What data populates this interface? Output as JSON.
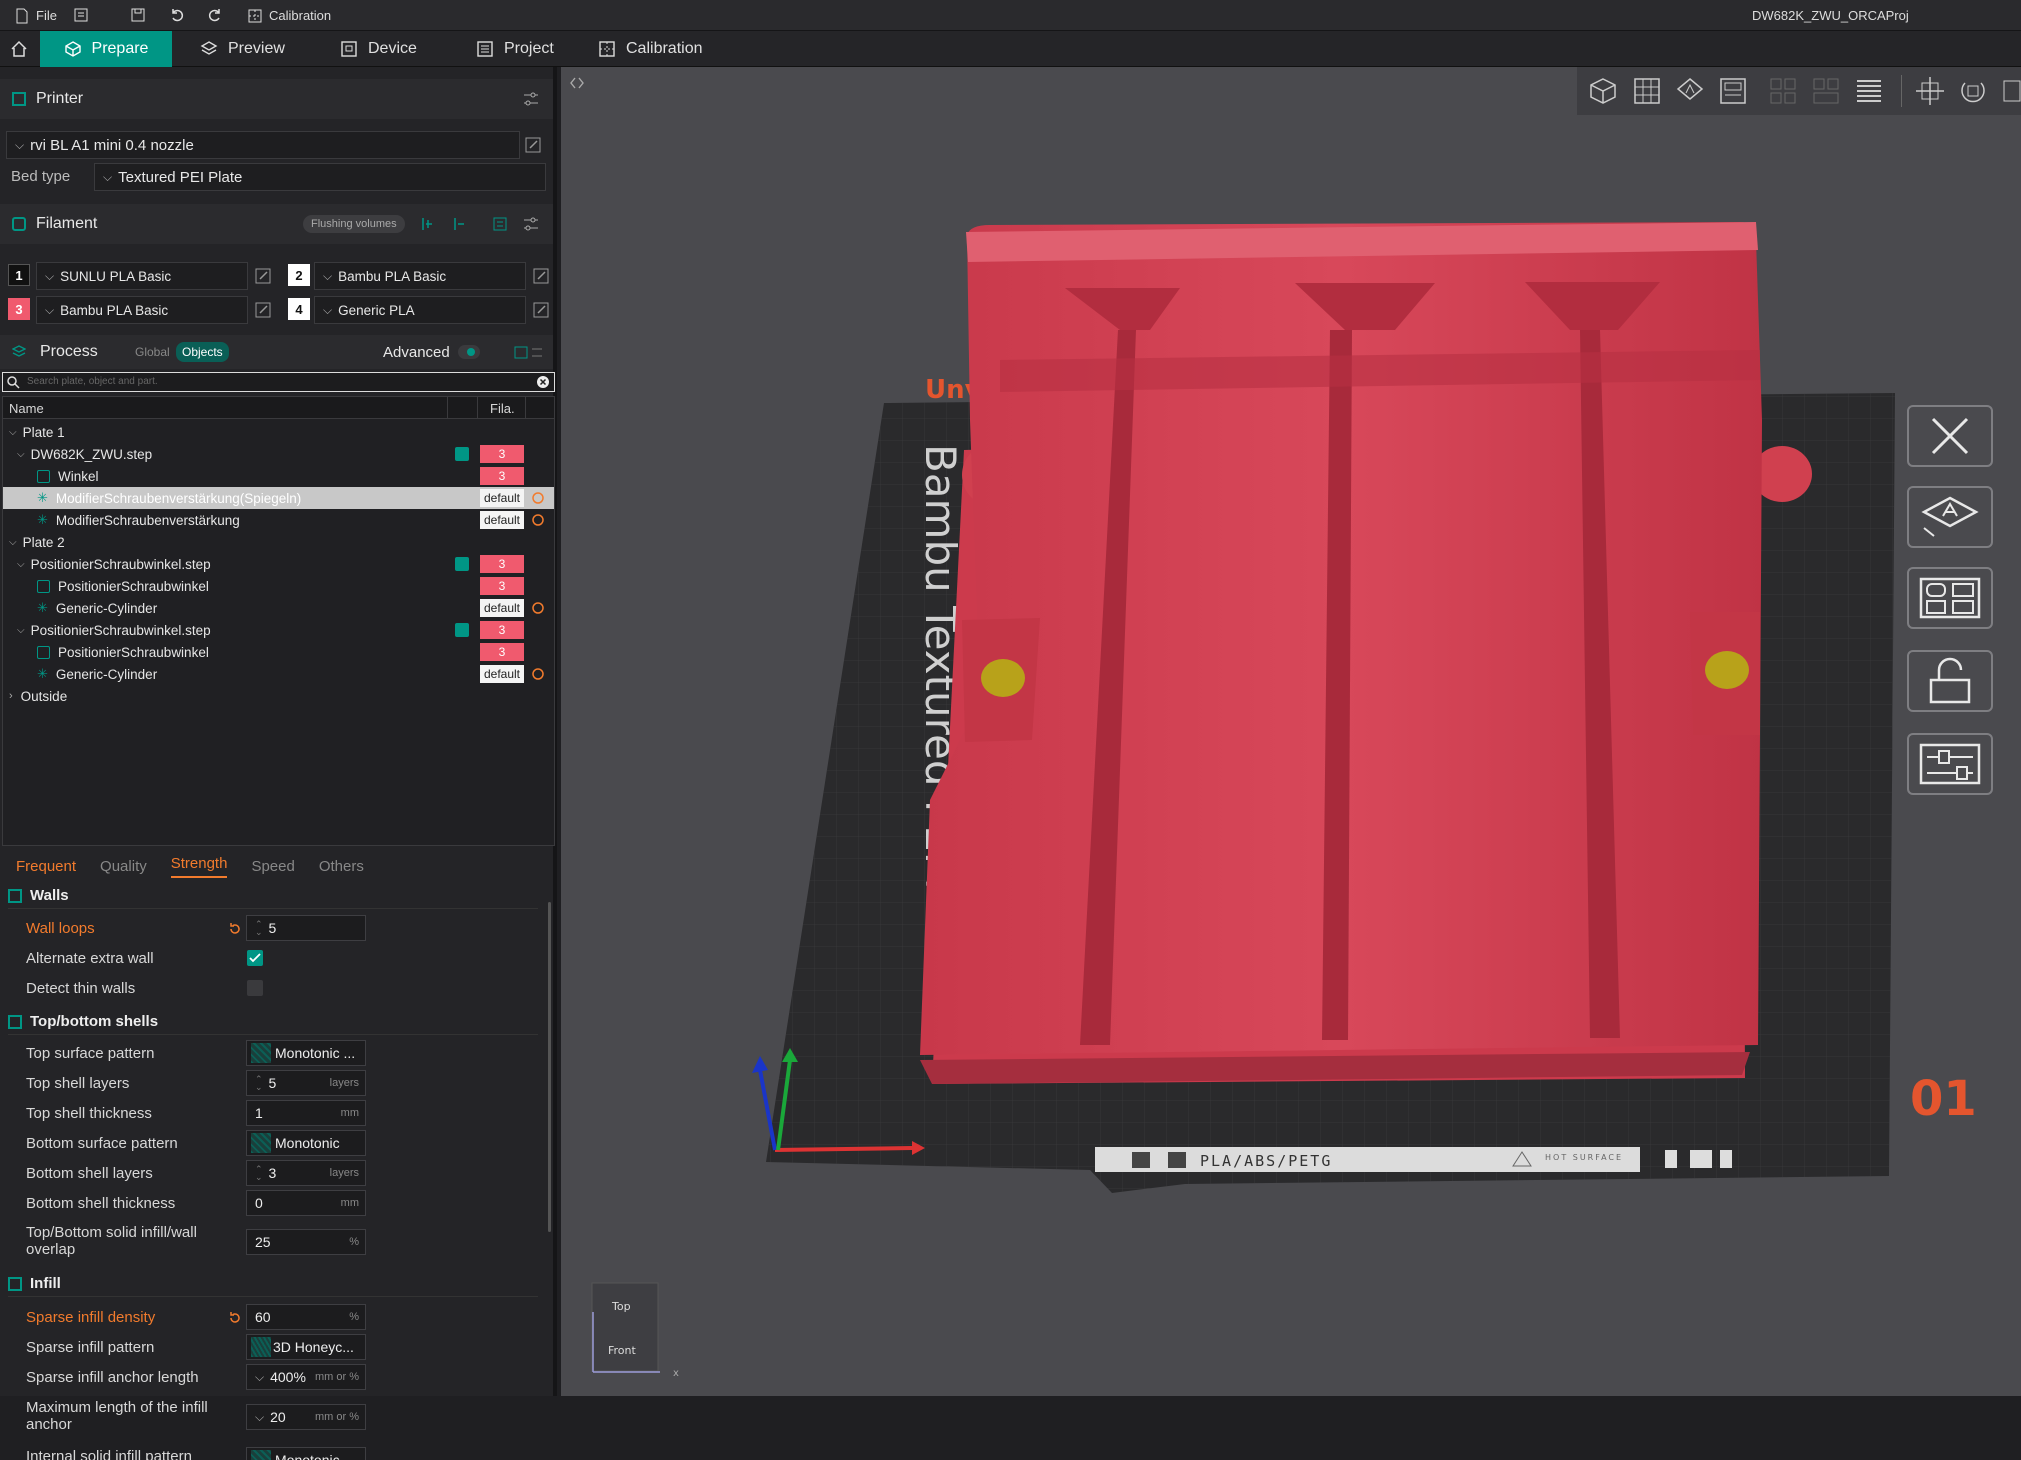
{
  "menubar": {
    "file": "File",
    "calibration": "Calibration",
    "project_title": "DW682K_ZWU_ORCAProj"
  },
  "tabs": [
    {
      "label": "Prepare"
    },
    {
      "label": "Preview"
    },
    {
      "label": "Device"
    },
    {
      "label": "Project"
    },
    {
      "label": "Calibration"
    }
  ],
  "printer": {
    "title": "Printer",
    "preset": "rvi BL A1 mini 0.4 nozzle",
    "bed_type_label": "Bed type",
    "bed_type": "Textured PEI Plate"
  },
  "filament": {
    "title": "Filament",
    "flushing": "Flushing volumes",
    "slots": [
      {
        "num": "1",
        "name": "SUNLU PLA Basic",
        "color": "#111111"
      },
      {
        "num": "2",
        "name": "Bambu PLA Basic",
        "color": "#ffffff"
      },
      {
        "num": "3",
        "name": "Bambu PLA Basic",
        "color": "#f05a6e"
      },
      {
        "num": "4",
        "name": "Generic PLA",
        "color": "#ffffff"
      }
    ]
  },
  "process": {
    "title": "Process",
    "global": "Global",
    "objects": "Objects",
    "advanced": "Advanced",
    "search_placeholder": "Search plate, object and part."
  },
  "tree": {
    "col_name": "Name",
    "col_fila": "Fila.",
    "rows": [
      {
        "label": "Plate 1",
        "fila": ""
      },
      {
        "label": "DW682K_ZWU.step",
        "fila": "3"
      },
      {
        "label": "Winkel",
        "fila": "3"
      },
      {
        "label": "ModifierSchraubenverstärkung(Spiegeln)",
        "fila": "default"
      },
      {
        "label": "ModifierSchraubenverstärkung",
        "fila": "default"
      },
      {
        "label": "Plate 2",
        "fila": ""
      },
      {
        "label": "PositionierSchraubwinkel.step",
        "fila": "3"
      },
      {
        "label": "PositionierSchraubwinkel",
        "fila": "3"
      },
      {
        "label": "Generic-Cylinder",
        "fila": "default"
      },
      {
        "label": "PositionierSchraubwinkel.step",
        "fila": "3"
      },
      {
        "label": "PositionierSchraubwinkel",
        "fila": "3"
      },
      {
        "label": "Generic-Cylinder",
        "fila": "default"
      },
      {
        "label": "Outside",
        "fila": ""
      }
    ]
  },
  "param_tabs": [
    "Frequent",
    "Quality",
    "Strength",
    "Speed",
    "Others"
  ],
  "groups": {
    "walls": "Walls",
    "topbottom": "Top/bottom shells",
    "infill": "Infill"
  },
  "options": {
    "wall_loops": {
      "label": "Wall loops",
      "value": "5"
    },
    "alt_wall": {
      "label": "Alternate extra wall"
    },
    "thin_walls": {
      "label": "Detect thin walls"
    },
    "top_pattern": {
      "label": "Top surface pattern",
      "value": "Monotonic ..."
    },
    "top_layers": {
      "label": "Top shell layers",
      "value": "5",
      "unit": "layers"
    },
    "top_thick": {
      "label": "Top shell thickness",
      "value": "1",
      "unit": "mm"
    },
    "bot_pattern": {
      "label": "Bottom surface pattern",
      "value": "Monotonic"
    },
    "bot_layers": {
      "label": "Bottom shell layers",
      "value": "3",
      "unit": "layers"
    },
    "bot_thick": {
      "label": "Bottom shell thickness",
      "value": "0",
      "unit": "mm"
    },
    "overlap": {
      "label": "Top/Bottom solid infill/wall overlap",
      "value": "25",
      "unit": "%"
    },
    "density": {
      "label": "Sparse infill density",
      "value": "60",
      "unit": "%"
    },
    "pattern": {
      "label": "Sparse infill pattern",
      "value": "3D Honeyc..."
    },
    "anchor": {
      "label": "Sparse infill anchor length",
      "value": "400%",
      "unit": "mm or %"
    },
    "anchor_max": {
      "label": "Maximum length of the infill anchor",
      "value": "20",
      "unit": "mm or %"
    },
    "internal": {
      "label": "Internal solid infill pattern",
      "value": "Monotonic"
    }
  },
  "viewport": {
    "plate_text": "Bambu Textured PEI Plate",
    "plate_number": "01",
    "plate_label": "PLA/ABS/PETG",
    "hot_surface": "HOT SURFACE",
    "view_top": "Top",
    "view_front": "Front",
    "unv": "Unv",
    "axis_x": "x"
  }
}
